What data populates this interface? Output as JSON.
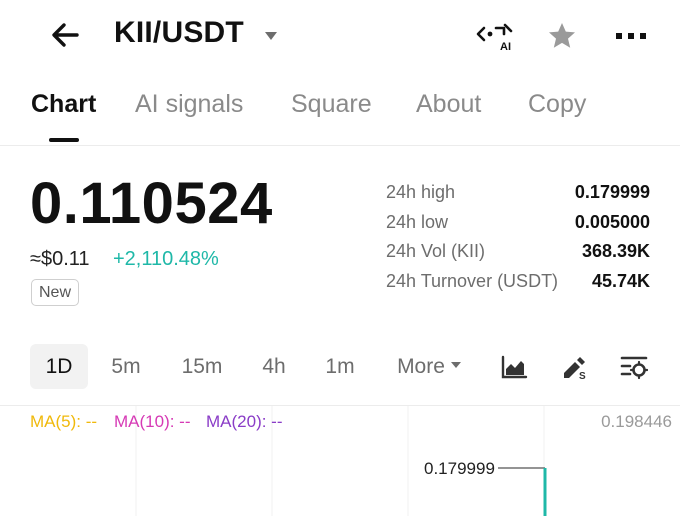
{
  "header": {
    "pair": "KII/USDT",
    "ai_label": "AI"
  },
  "tabs": [
    {
      "label": "Chart",
      "active": true
    },
    {
      "label": "AI signals"
    },
    {
      "label": "Square"
    },
    {
      "label": "About"
    },
    {
      "label": "Copy"
    }
  ],
  "ticker": {
    "last_price": "0.110524",
    "usd_price": "≈$0.11",
    "change": "+2,110.48%",
    "badge": "New"
  },
  "stats": [
    {
      "label": "24h high",
      "value": "0.179999"
    },
    {
      "label": "24h low",
      "value": "0.005000"
    },
    {
      "label": "24h Vol (KII)",
      "value": "368.39K"
    },
    {
      "label": "24h Turnover (USDT)",
      "value": "45.74K"
    }
  ],
  "intervals": [
    {
      "label": "1D",
      "active": true
    },
    {
      "label": "5m"
    },
    {
      "label": "15m"
    },
    {
      "label": "4h"
    },
    {
      "label": "1m"
    },
    {
      "label": "More"
    }
  ],
  "chart_tools": [
    "chart-type-icon",
    "draw-tool-icon",
    "indicator-settings-icon"
  ],
  "chart": {
    "ma5": "MA(5): --",
    "ma10": "MA(10): --",
    "ma20": "MA(20): --",
    "axis_top": "0.198446",
    "high_marker": "0.179999"
  },
  "colors": {
    "up": "#1fb8a8",
    "ma5": "#f0b90b",
    "ma10": "#d63ab5",
    "ma20": "#8a3cc7"
  }
}
